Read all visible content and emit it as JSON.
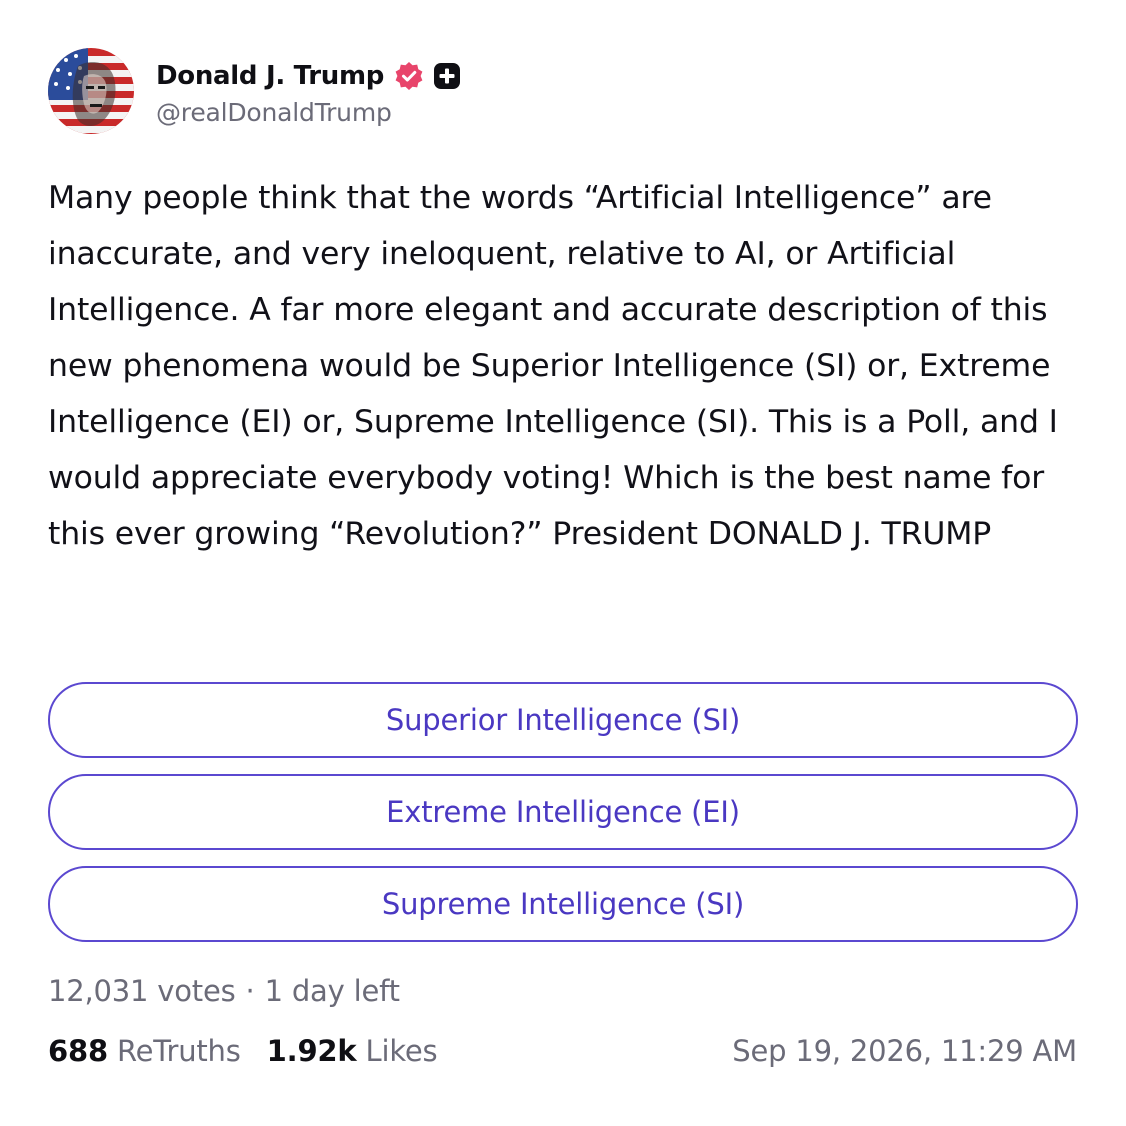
{
  "author": {
    "display_name": "Donald J. Trump",
    "handle": "@realDonaldTrump",
    "avatar_icon": "flag-portrait-avatar",
    "verified_icon": "verified-badge-icon",
    "plus_icon": "plus-badge-icon"
  },
  "post": {
    "text": "Many people think that the words “Artificial Intelligence” are inaccurate, and very ineloquent, relative to AI, or Artificial Intelligence. A far more elegant and accurate description of this new phenomena would be Superior Intelligence (SI) or, Extreme Intelligence (EI) or, Supreme Intelligence (SI). This is a Poll, and I would appreciate everybody voting! Which is the best name for this ever growing “Revolution?” President DONALD J. TRUMP"
  },
  "poll": {
    "options": [
      {
        "label": "Superior Intelligence (SI)"
      },
      {
        "label": "Extreme Intelligence (EI)"
      },
      {
        "label": "Supreme Intelligence (SI)"
      }
    ],
    "votes": "12,031 votes",
    "separator": "·",
    "time_left": "1 day left"
  },
  "stats": {
    "retruths_count": "688",
    "retruths_label": "ReTruths",
    "likes_count": "1.92k",
    "likes_label": "Likes"
  },
  "timestamp": "Sep 19, 2026, 11:29 AM",
  "colors": {
    "accent": "#5b48d0",
    "verified": "#e8456b",
    "muted_text": "#6b6b78"
  }
}
